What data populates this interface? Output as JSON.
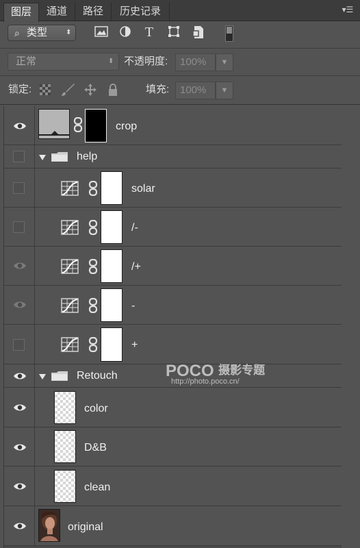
{
  "tabs": [
    {
      "label": "图层",
      "active": true
    },
    {
      "label": "通道",
      "active": false
    },
    {
      "label": "路径",
      "active": false
    },
    {
      "label": "历史记录",
      "active": false
    }
  ],
  "filter": {
    "kind_label": "类型",
    "icons": [
      "image-filter-icon",
      "adjustment-filter-icon",
      "type-filter-icon",
      "shape-filter-icon",
      "smart-object-filter-icon"
    ]
  },
  "blend": {
    "mode": "正常",
    "opacity_label": "不透明度:",
    "opacity_value": "100%"
  },
  "lock": {
    "label": "锁定:",
    "fill_label": "填充:",
    "fill_value": "100%"
  },
  "layers": [
    {
      "name": "crop",
      "visible": true,
      "type": "masked-layer"
    },
    {
      "name": "help",
      "visible": false,
      "type": "group"
    },
    {
      "name": "solar",
      "visible": false,
      "type": "curves"
    },
    {
      "name": "/-",
      "visible": false,
      "type": "curves"
    },
    {
      "name": "/+",
      "visible": "dim",
      "type": "curves"
    },
    {
      "name": "-",
      "visible": "dim",
      "type": "curves"
    },
    {
      "name": "+",
      "visible": false,
      "type": "curves"
    },
    {
      "name": "Retouch",
      "visible": true,
      "type": "group"
    },
    {
      "name": "color",
      "visible": true,
      "type": "pixel"
    },
    {
      "name": "D&B",
      "visible": true,
      "type": "pixel"
    },
    {
      "name": "clean",
      "visible": true,
      "type": "pixel"
    },
    {
      "name": "original",
      "visible": true,
      "type": "photo"
    }
  ],
  "watermark": {
    "brand": "POCO",
    "brand_cn": "摄影专题",
    "url": "http://photo.poco.cn/"
  }
}
